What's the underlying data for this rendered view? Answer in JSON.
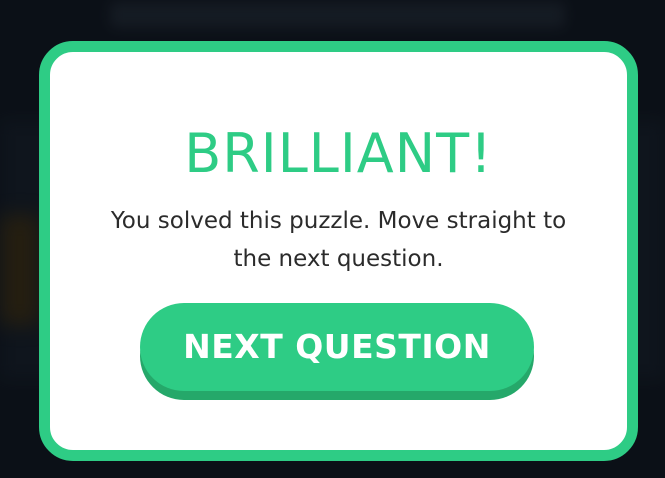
{
  "modal": {
    "title": "BRILLIANT!",
    "message": "You solved this puzzle. Move straight to the next question.",
    "next_button_label": "NEXT QUESTION"
  },
  "colors": {
    "accent": "#2ecc85",
    "accent_shadow": "#25a86a",
    "background": "#0f151d"
  }
}
